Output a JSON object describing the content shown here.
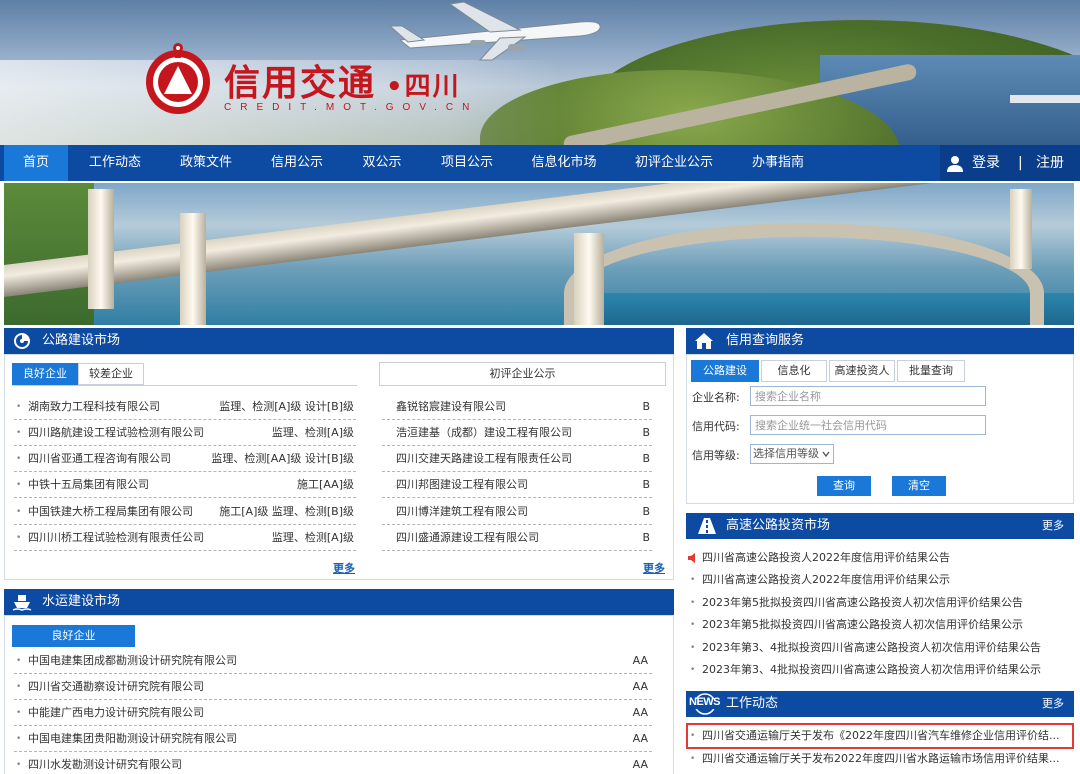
{
  "header": {
    "logo_text": "信用交通",
    "logo_region": "•四川",
    "logo_url_text": "CREDIT.MOT.GOV.CN",
    "brand_red": "#c4161c"
  },
  "nav": {
    "items": [
      "首页",
      "工作动态",
      "政策文件",
      "信用公示",
      "双公示",
      "项目公示",
      "信息化市场",
      "初评企业公示",
      "办事指南"
    ],
    "active_index": 0,
    "login": "登录",
    "separator": "|",
    "register": "注册",
    "bg_color": "#0d4aa2",
    "active_color": "#1a78d9"
  },
  "highway_market": {
    "title": "公路建设市场",
    "tabs": [
      "良好企业",
      "较差企业"
    ],
    "active_tab": 0,
    "good_list": [
      {
        "name": "湖南致力工程科技有限公司",
        "grade": "监理、检测[A]级 设计[B]级"
      },
      {
        "name": "四川路航建设工程试验检测有限公司",
        "grade": "监理、检测[A]级"
      },
      {
        "name": "四川省亚通工程咨询有限公司",
        "grade": "监理、检测[AA]级 设计[B]级"
      },
      {
        "name": "中铁十五局集团有限公司",
        "grade": "施工[AA]级"
      },
      {
        "name": "中国铁建大桥工程局集团有限公司",
        "grade": "施工[A]级 监理、检测[B]级"
      },
      {
        "name": "四川川桥工程试验检测有限责任公司",
        "grade": "监理、检测[A]级"
      }
    ],
    "more_left": "更多",
    "prelim_title": "初评企业公示",
    "prelim_list": [
      {
        "name": "鑫锐铭宸建设有限公司",
        "grade": "B"
      },
      {
        "name": "浩洹建基（成都）建设工程有限公司",
        "grade": "B"
      },
      {
        "name": "四川交建天路建设工程有限责任公司",
        "grade": "B"
      },
      {
        "name": "四川邦图建设工程有限公司",
        "grade": "B"
      },
      {
        "name": "四川博洋建筑工程有限公司",
        "grade": "B"
      },
      {
        "name": "四川盛通源建设工程有限公司",
        "grade": "B"
      }
    ],
    "more_right": "更多"
  },
  "water_market": {
    "title": "水运建设市场",
    "tab": "良好企业",
    "list": [
      {
        "name": "中国电建集团成都勘测设计研究院有限公司",
        "grade": "AA"
      },
      {
        "name": "四川省交通勘察设计研究院有限公司",
        "grade": "AA"
      },
      {
        "name": "中能建广西电力设计研究院有限公司",
        "grade": "AA"
      },
      {
        "name": "中国电建集团贵阳勘测设计研究院有限公司",
        "grade": "AA"
      },
      {
        "name": "四川水发勘测设计研究有限公司",
        "grade": "AA"
      }
    ]
  },
  "credit_query": {
    "title": "信用查询服务",
    "tabs": [
      "公路建设",
      "信息化",
      "高速投资人",
      "批量查询"
    ],
    "active_tab": 0,
    "company_label": "企业名称:",
    "company_placeholder": "搜索企业名称",
    "code_label": "信用代码:",
    "code_placeholder": "搜索企业统一社会信用代码",
    "level_label": "信用等级:",
    "level_selected": "选择信用等级",
    "search_button": "查询",
    "clear_button": "清空"
  },
  "highway_investment": {
    "title": "高速公路投资市场",
    "more": "更多",
    "items": [
      "四川省高速公路投资人2022年度信用评价结果公告",
      "四川省高速公路投资人2022年度信用评价结果公示",
      "2023年第5批拟投资四川省高速公路投资人初次信用评价结果公告",
      "2023年第5批拟投资四川省高速公路投资人初次信用评价结果公示",
      "2023年第3、4批拟投资四川省高速公路投资人初次信用评价结果公告",
      "2023年第3、4批拟投资四川省高速公路投资人初次信用评价结果公示"
    ]
  },
  "work_news": {
    "title": "工作动态",
    "icon_text": "NEWS",
    "more": "更多",
    "items": [
      "四川省交通运输厅关于发布《2022年度四川省汽车维修企业信用评价结...",
      "四川省交通运输厅关于发布2022年度四川省水路运输市场信用评价结果..."
    ]
  }
}
